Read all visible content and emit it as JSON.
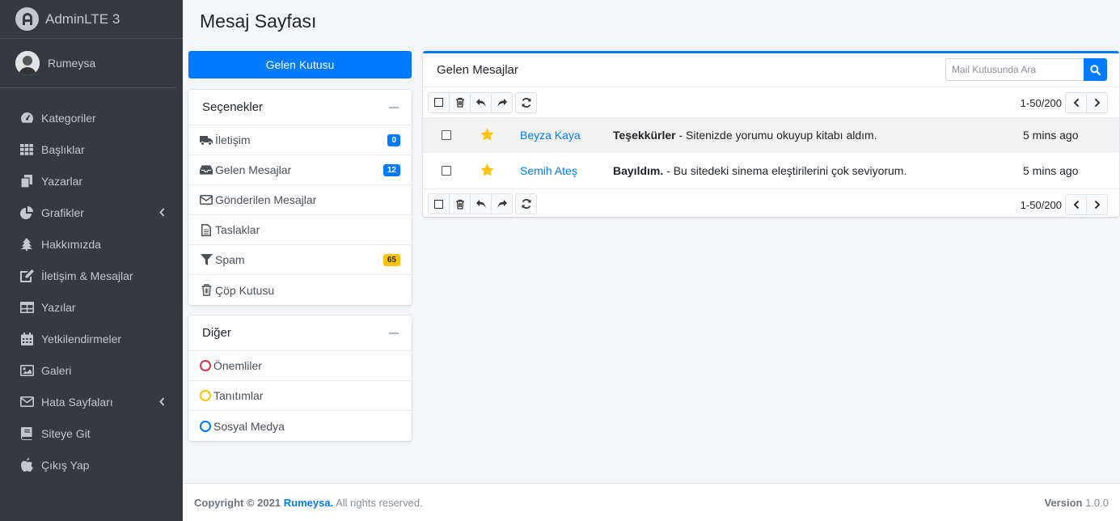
{
  "brand": {
    "name": "AdminLTE 3"
  },
  "user": {
    "name": "Rumeysa"
  },
  "sidebar": {
    "items": [
      {
        "label": "Kategoriler",
        "icon": "dashboard-icon",
        "arrow": false
      },
      {
        "label": "Başlıklar",
        "icon": "grid-icon",
        "arrow": false
      },
      {
        "label": "Yazarlar",
        "icon": "copy-icon",
        "arrow": false
      },
      {
        "label": "Grafikler",
        "icon": "pie-chart-icon",
        "arrow": true
      },
      {
        "label": "Hakkımızda",
        "icon": "tree-icon",
        "arrow": false
      },
      {
        "label": "İletişim & Mesajlar",
        "icon": "edit-icon",
        "arrow": false
      },
      {
        "label": "Yazılar",
        "icon": "table-icon",
        "arrow": false
      },
      {
        "label": "Yetkilendirmeler",
        "icon": "calendar-icon",
        "arrow": false
      },
      {
        "label": "Galeri",
        "icon": "image-icon",
        "arrow": false
      },
      {
        "label": "Hata Sayfaları",
        "icon": "envelope-icon",
        "arrow": true
      },
      {
        "label": "Siteye Git",
        "icon": "book-icon",
        "arrow": false
      },
      {
        "label": "Çıkış Yap",
        "icon": "apple-icon",
        "arrow": false
      }
    ]
  },
  "page": {
    "title": "Mesaj Sayfası"
  },
  "compose": {
    "label": "Gelen Kutusu"
  },
  "folders": {
    "title": "Seçenekler",
    "items": [
      {
        "label": "İletişim",
        "icon": "truck-icon",
        "badge": "0",
        "badge_color": "#007bff"
      },
      {
        "label": "Gelen Mesajlar",
        "icon": "inbox-icon",
        "badge": "12",
        "badge_color": "#007bff"
      },
      {
        "label": "Gönderilen Mesajlar",
        "icon": "envelope-outline-icon",
        "badge": "",
        "badge_color": ""
      },
      {
        "label": "Taslaklar",
        "icon": "file-icon",
        "badge": "",
        "badge_color": ""
      },
      {
        "label": "Spam",
        "icon": "filter-icon",
        "badge": "65",
        "badge_color": "#ffc107"
      },
      {
        "label": "Çöp Kutusu",
        "icon": "trash-icon",
        "badge": "",
        "badge_color": ""
      }
    ]
  },
  "labels": {
    "title": "Diğer",
    "items": [
      {
        "label": "Önemliler",
        "color": "#dc3545"
      },
      {
        "label": "Tanıtımlar",
        "color": "#ffc107"
      },
      {
        "label": "Sosyal Medya",
        "color": "#007bff"
      }
    ]
  },
  "mailbox": {
    "title": "Gelen Mesajlar",
    "search_placeholder": "Mail Kutusunda Ara",
    "pager_text": "1-50/200",
    "messages": [
      {
        "sender": "Beyza Kaya",
        "subject_bold": "Teşekkürler",
        "subject_rest": " - Sitenizde yorumu okuyup kitabı aldım.",
        "time": "5 mins ago",
        "starred": true
      },
      {
        "sender": "Semih Ateş",
        "subject_bold": "Bayıldım.",
        "subject_rest": " - Bu sitedeki sinema eleştirilerini çok seviyorum.",
        "time": "5 mins ago",
        "starred": true
      }
    ]
  },
  "footer": {
    "copyright": "Copyright © 2021",
    "author": "Rumeysa.",
    "rights": "All rights reserved.",
    "version_label": "Version",
    "version_value": "1.0.0"
  },
  "colors": {
    "primary": "#007bff",
    "sidebar_bg": "#343a40",
    "star": "#ffc107"
  }
}
